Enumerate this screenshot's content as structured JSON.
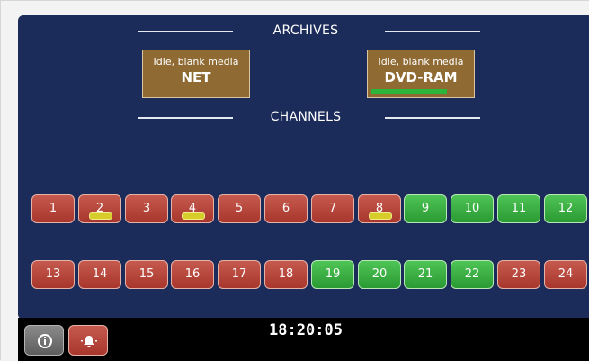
{
  "archives": {
    "title": "ARCHIVES",
    "items": [
      {
        "status": "Idle, blank media",
        "name": "NET",
        "progress": null
      },
      {
        "status": "Idle, blank media",
        "name": "DVD-RAM",
        "progress": 0.75
      }
    ]
  },
  "channels": {
    "title": "CHANNELS",
    "rows": [
      [
        {
          "number": "1",
          "state": "red",
          "indicator": false
        },
        {
          "number": "2",
          "state": "red",
          "indicator": true
        },
        {
          "number": "3",
          "state": "red",
          "indicator": false
        },
        {
          "number": "4",
          "state": "red",
          "indicator": true
        },
        {
          "number": "5",
          "state": "red",
          "indicator": false
        },
        {
          "number": "6",
          "state": "red",
          "indicator": false
        },
        {
          "number": "7",
          "state": "red",
          "indicator": false
        },
        {
          "number": "8",
          "state": "red",
          "indicator": true
        },
        {
          "number": "9",
          "state": "green",
          "indicator": false
        },
        {
          "number": "10",
          "state": "green",
          "indicator": false
        },
        {
          "number": "11",
          "state": "green",
          "indicator": false
        },
        {
          "number": "12",
          "state": "green",
          "indicator": false
        }
      ],
      [
        {
          "number": "13",
          "state": "red",
          "indicator": false
        },
        {
          "number": "14",
          "state": "red",
          "indicator": false
        },
        {
          "number": "15",
          "state": "red",
          "indicator": false
        },
        {
          "number": "16",
          "state": "red",
          "indicator": false
        },
        {
          "number": "17",
          "state": "red",
          "indicator": false
        },
        {
          "number": "18",
          "state": "red",
          "indicator": false
        },
        {
          "number": "19",
          "state": "green",
          "indicator": false
        },
        {
          "number": "20",
          "state": "green",
          "indicator": false
        },
        {
          "number": "21",
          "state": "green",
          "indicator": false
        },
        {
          "number": "22",
          "state": "green",
          "indicator": false
        },
        {
          "number": "23",
          "state": "red",
          "indicator": false
        },
        {
          "number": "24",
          "state": "red",
          "indicator": false
        }
      ]
    ]
  },
  "statusbar": {
    "clock": "18:20:05",
    "buttons": [
      {
        "icon": "info-icon"
      },
      {
        "icon": "alarm-bell-icon"
      }
    ]
  },
  "colors": {
    "panel": "#1b2c5a",
    "channel_red": "#b54438",
    "channel_green": "#3aaf43",
    "archive_box": "#8f6a33",
    "indicator": "#d6cd2a",
    "progress": "#2bb53a"
  }
}
